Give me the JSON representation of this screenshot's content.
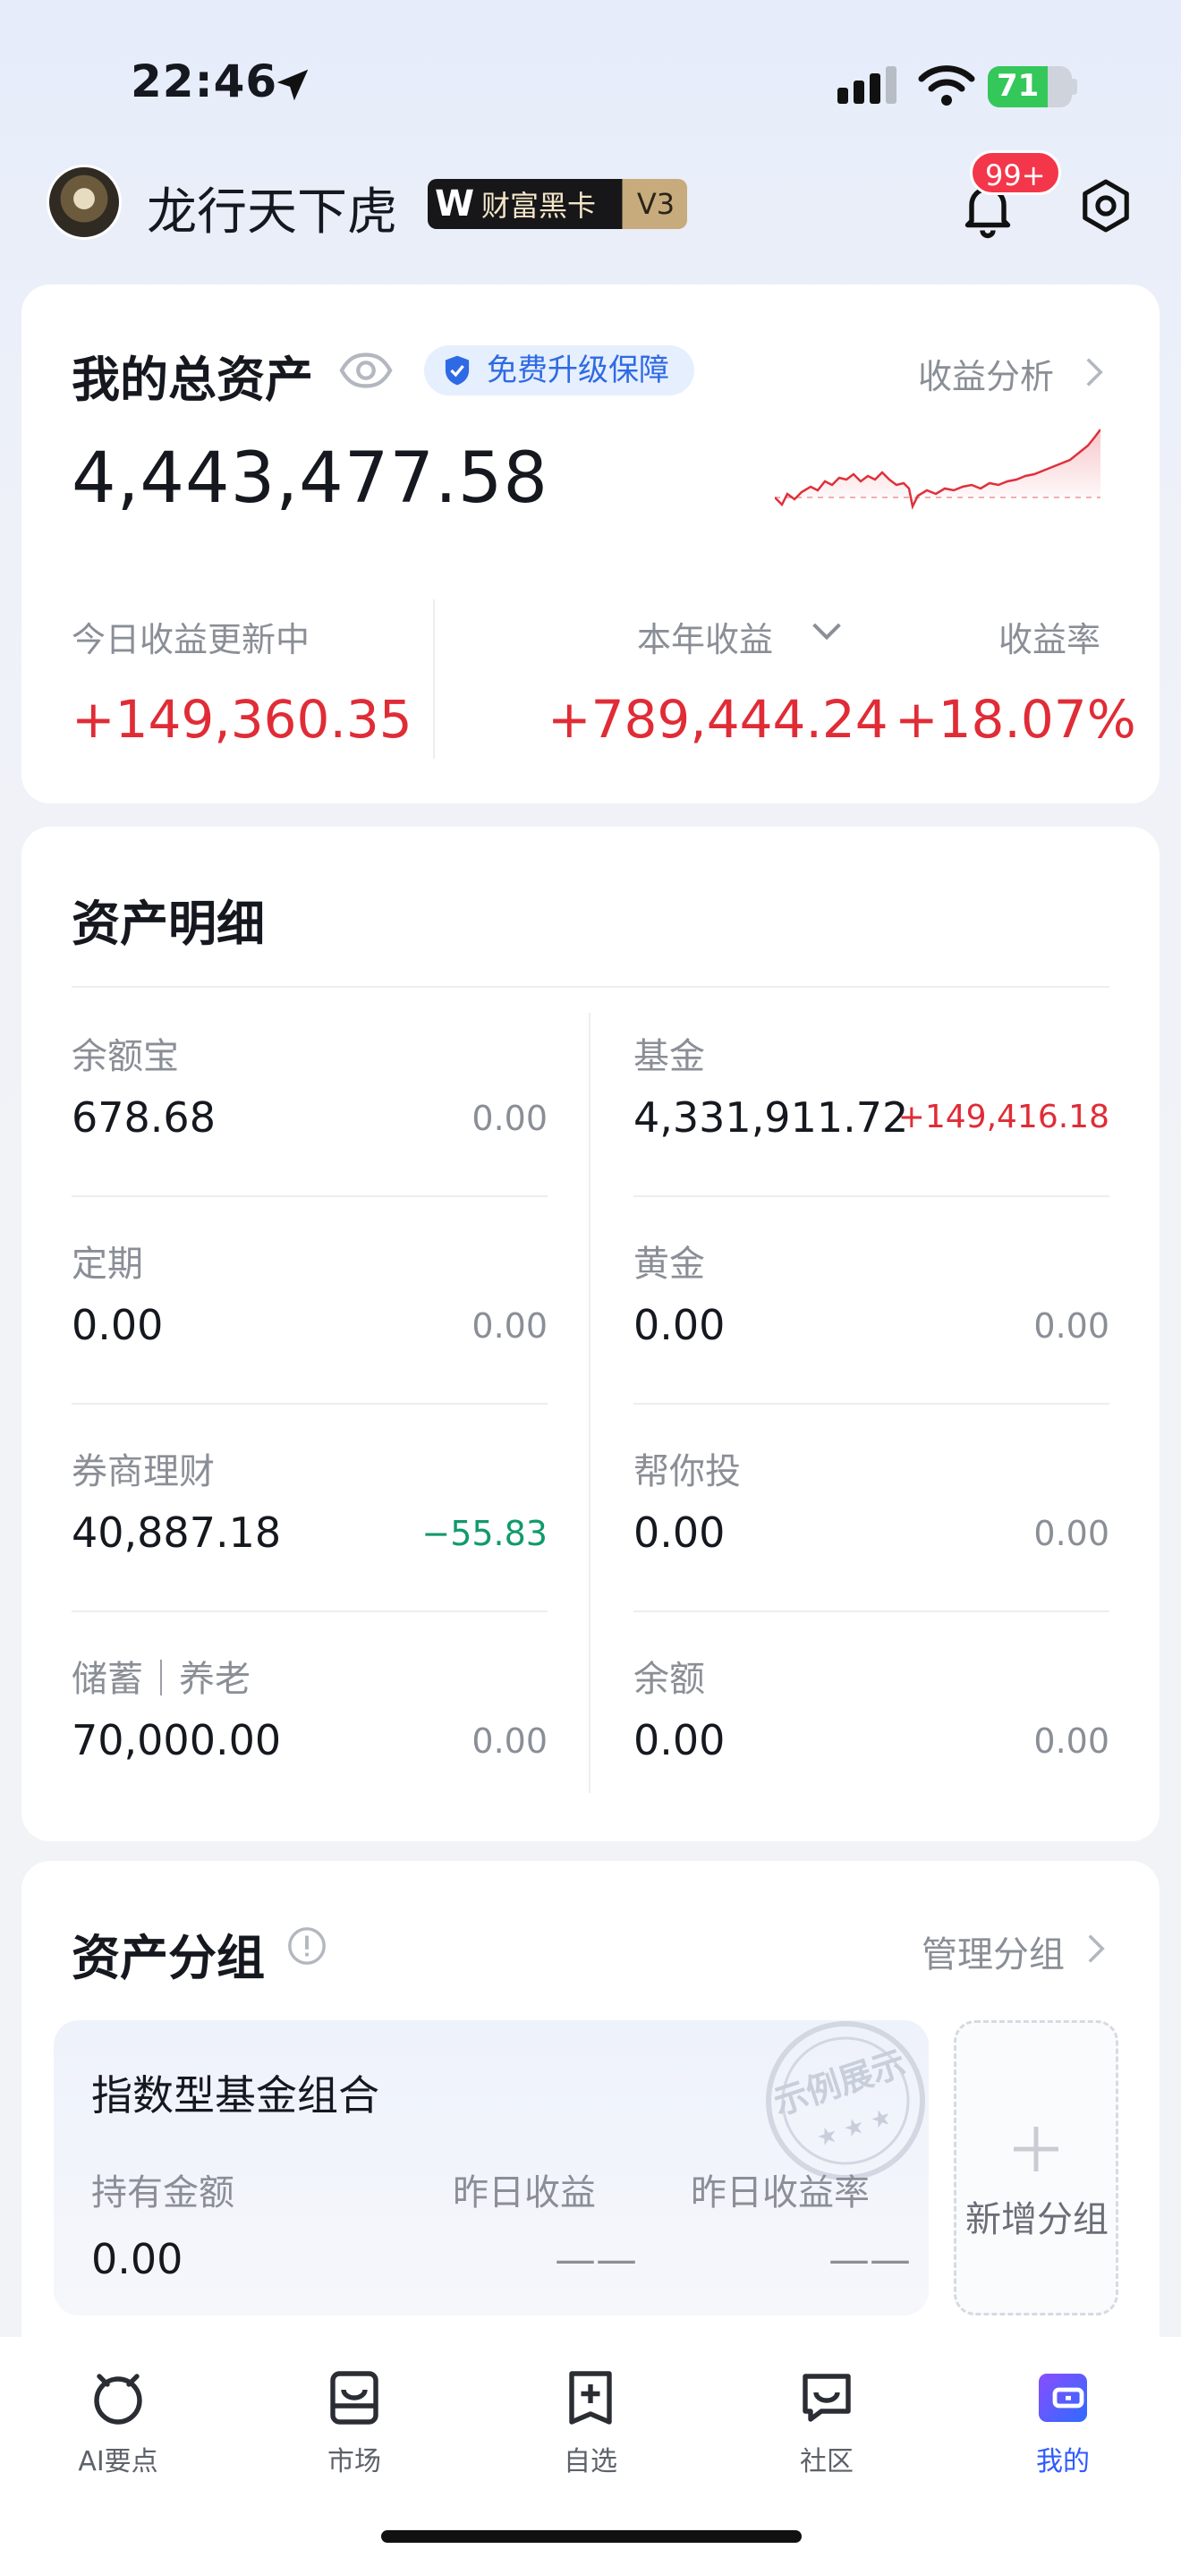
{
  "status_bar": {
    "time": "22:46",
    "battery": "71",
    "battery_level": 0.71
  },
  "header": {
    "user_name": "龙行天下虎",
    "vip_card": "财富黑卡",
    "vip_level": "V3",
    "notification_count": "99+"
  },
  "summary": {
    "title": "我的总资产",
    "protect_badge": "免费升级保障",
    "analysis_link": "收益分析",
    "total_value": "4,443,477.58",
    "today_label": "今日收益更新中",
    "today_value": "+149,360.35",
    "year_label": "本年收益",
    "year_value": "+789,444.24",
    "rate_label": "收益率",
    "rate_value": "+18.07%"
  },
  "detail": {
    "title": "资产明细",
    "left": [
      {
        "label": "余额宝",
        "value": "678.68",
        "change": "0.00"
      },
      {
        "label": "定期",
        "value": "0.00",
        "change": "0.00"
      },
      {
        "label": "券商理财",
        "value": "40,887.18",
        "change": "−55.83"
      },
      {
        "label": "储蓄｜养老",
        "value": "70,000.00",
        "change": "0.00"
      }
    ],
    "right": [
      {
        "label": "基金",
        "value": "4,331,911.72",
        "change": "+149,416.18"
      },
      {
        "label": "黄金",
        "value": "0.00",
        "change": "0.00"
      },
      {
        "label": "帮你投",
        "value": "0.00",
        "change": "0.00"
      },
      {
        "label": "余额",
        "value": "0.00",
        "change": "0.00"
      }
    ]
  },
  "groups": {
    "title": "资产分组",
    "manage_link": "管理分组",
    "card": {
      "name": "指数型基金组合",
      "stamp": "示例展示",
      "hold_label": "持有金额",
      "hold_value": "0.00",
      "yest_label": "昨日收益",
      "yest_value": "——",
      "rate_label": "昨日收益率",
      "rate_value": "——"
    },
    "add_label": "新增分组"
  },
  "tabbar": [
    {
      "label": "AI要点",
      "icon": "ai-icon"
    },
    {
      "label": "市场",
      "icon": "market-icon"
    },
    {
      "label": "自选",
      "icon": "watchlist-icon"
    },
    {
      "label": "社区",
      "icon": "community-icon"
    },
    {
      "label": "我的",
      "icon": "wallet-icon"
    }
  ],
  "colors": {
    "rise": "#e02c36",
    "fall": "#119a6a",
    "accent": "#2f5bff"
  }
}
